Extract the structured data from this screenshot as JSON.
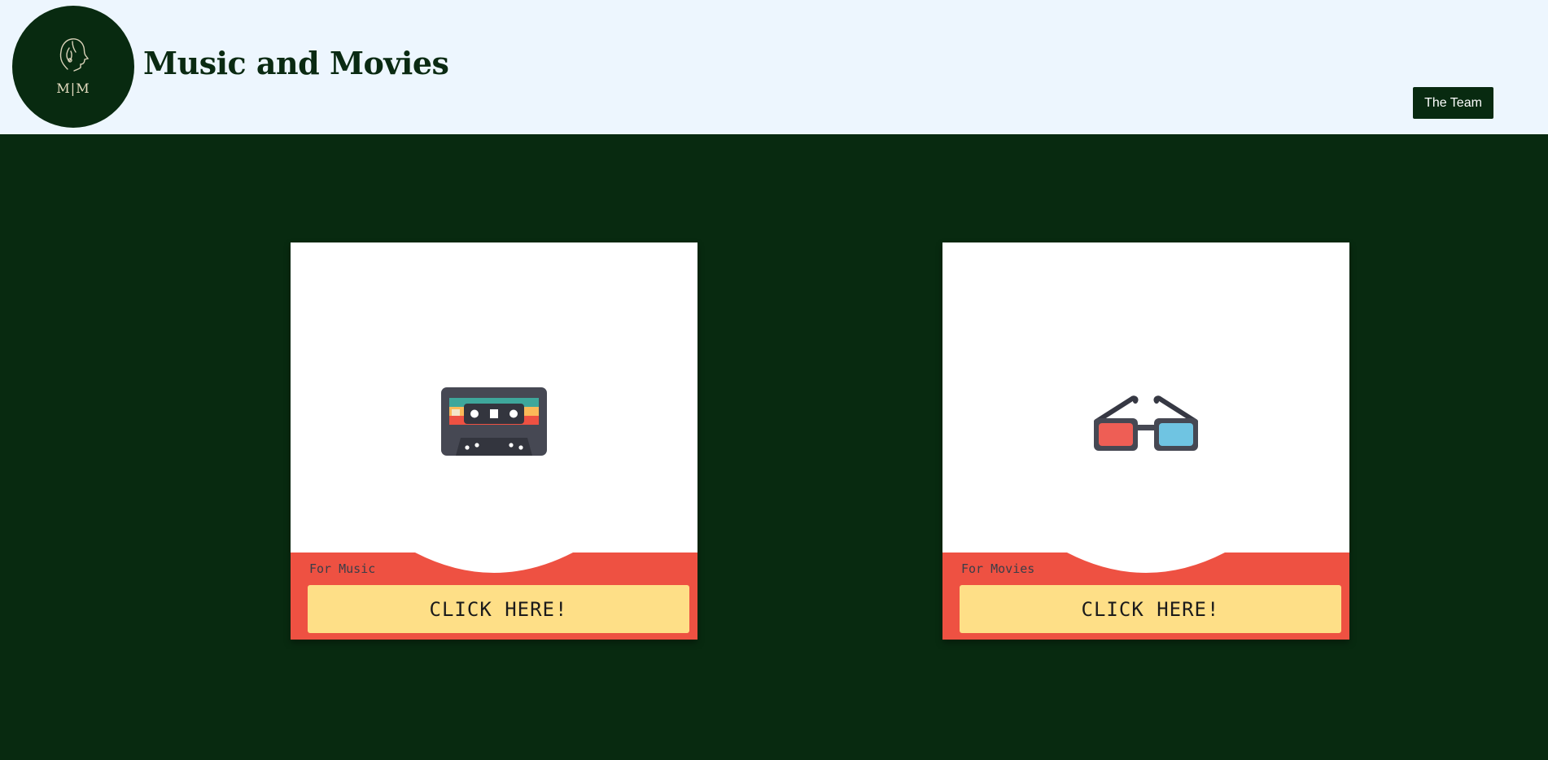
{
  "header": {
    "logo_text": "M|M",
    "site_title": "Music and Movies",
    "team_button_label": "The Team"
  },
  "cards": [
    {
      "icon": "cassette-tape-icon",
      "caption": "For Music",
      "button_label": "CLICK HERE!"
    },
    {
      "icon": "3d-glasses-icon",
      "caption": "For Movies",
      "button_label": "CLICK HERE!"
    }
  ],
  "colors": {
    "header_bg": "#edf6fe",
    "page_bg": "#082a10",
    "card_footer": "#ee5142",
    "button_bg": "#fedf87",
    "title_color": "#0a2a12"
  }
}
